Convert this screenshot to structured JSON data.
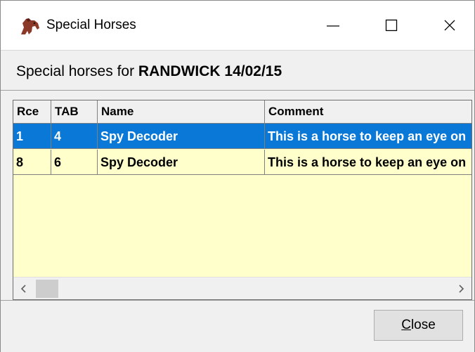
{
  "window": {
    "title": "Special Horses",
    "icon": "horse-icon",
    "controls": [
      "minimize-icon",
      "maximize-icon",
      "close-icon"
    ]
  },
  "header": {
    "prefix": "Special horses for ",
    "venue": "RANDWICK 14/02/15"
  },
  "table": {
    "columns": [
      "Rce",
      "TAB",
      "Name",
      "Comment"
    ],
    "rows": [
      {
        "rce": "1",
        "tab": "4",
        "name": "Spy Decoder",
        "comment": "This is a horse to keep an eye on",
        "selected": true
      },
      {
        "rce": "8",
        "tab": "6",
        "name": "Spy Decoder",
        "comment": "This is a horse to keep an eye on",
        "selected": false
      }
    ]
  },
  "footer": {
    "close_label_underlined": "C",
    "close_label_rest": "lose"
  },
  "colors": {
    "selection": "#0a78d7",
    "grid_background": "#ffffcc"
  }
}
